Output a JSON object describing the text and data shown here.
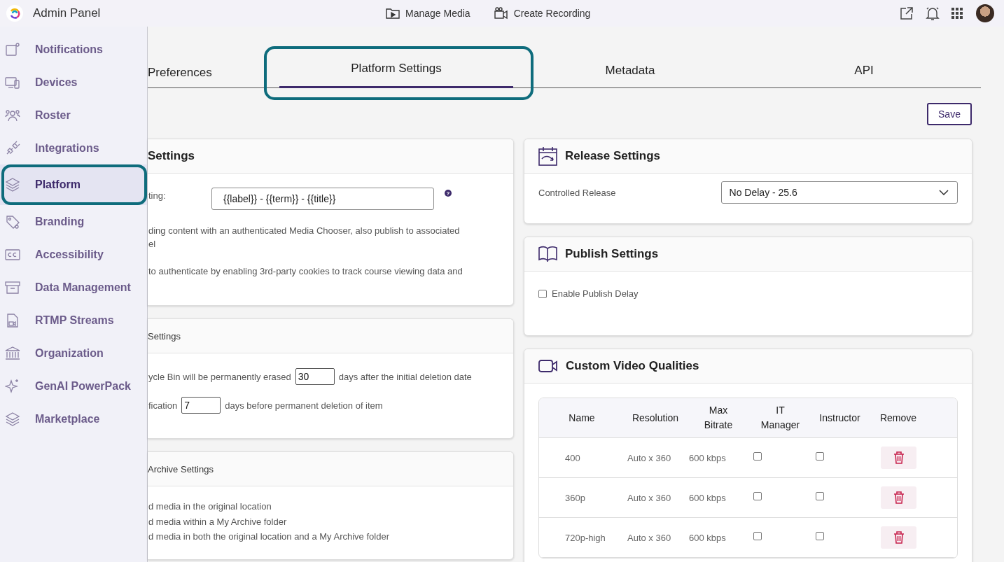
{
  "header": {
    "title": "Admin Panel",
    "actions": [
      {
        "label": "Manage Media"
      },
      {
        "label": "Create Recording"
      }
    ]
  },
  "sidebar": {
    "items": [
      {
        "label": "Notifications",
        "selected": false,
        "highlighted": false
      },
      {
        "label": "Devices",
        "selected": false,
        "highlighted": false
      },
      {
        "label": "Roster",
        "selected": false,
        "highlighted": false
      },
      {
        "label": "Integrations",
        "selected": false,
        "highlighted": false
      },
      {
        "label": "Platform",
        "selected": true,
        "highlighted": true
      },
      {
        "label": "Branding",
        "selected": false,
        "highlighted": false
      },
      {
        "label": "Accessibility",
        "selected": false,
        "highlighted": false
      },
      {
        "label": "Data Management",
        "selected": false,
        "highlighted": false
      },
      {
        "label": "RTMP Streams",
        "selected": false,
        "highlighted": false
      },
      {
        "label": "Organization",
        "selected": false,
        "highlighted": false
      },
      {
        "label": "GenAI PowerPack",
        "selected": false,
        "highlighted": false
      },
      {
        "label": "Marketplace",
        "selected": false,
        "highlighted": false
      }
    ]
  },
  "tabs": [
    {
      "label": "Preferences",
      "selected": false,
      "highlighted": false
    },
    {
      "label": "Platform Settings",
      "selected": true,
      "highlighted": true
    },
    {
      "label": "Metadata",
      "selected": false,
      "highlighted": false
    },
    {
      "label": "API",
      "selected": false,
      "highlighted": false
    }
  ],
  "save_button": "Save",
  "left_cards": [
    {
      "kind": "major",
      "title": "Settings",
      "rows": [
        {
          "kind": "field",
          "label": "ting:",
          "value": "{{label}} - {{term}} - {{title}}",
          "help": "?"
        },
        {
          "kind": "text",
          "text": "ding content with an authenticated Media Chooser, also publish to associated\nel"
        },
        {
          "kind": "text",
          "text": "to authenticate by enabling 3rd-party cookies to track course viewing data and"
        }
      ]
    },
    {
      "kind": "minor",
      "title": "Settings",
      "rows": [
        {
          "kind": "inline_input",
          "before": "ycle Bin will be permanently erased",
          "value": "30",
          "after": "days after the initial deletion date"
        },
        {
          "kind": "inline_input",
          "before": "fication",
          "value": "7",
          "after": "days before permanent deletion of item"
        }
      ]
    },
    {
      "kind": "minor",
      "title": "Archive Settings",
      "rows": [
        {
          "kind": "line",
          "text": "d media in the original location"
        },
        {
          "kind": "line",
          "text": "d media within a My Archive folder"
        },
        {
          "kind": "line",
          "text": "d media in both the original location and a My Archive folder"
        }
      ]
    }
  ],
  "right_cards": [
    {
      "kind": "major",
      "title": "Release Settings",
      "rows": [
        {
          "kind": "select",
          "label": "Controlled Release",
          "value": "No Delay - 25.6"
        }
      ]
    },
    {
      "kind": "major",
      "title": "Publish Settings",
      "rows": [
        {
          "kind": "checkbox",
          "label": "Enable Publish Delay",
          "checked": false
        }
      ]
    },
    {
      "kind": "major",
      "title": "Custom Video Qualities",
      "rows": [
        {
          "kind": "table",
          "columns": [
            "Name",
            "Resolution",
            "Max Bitrate",
            "IT Manager",
            "Instructor",
            "Remove"
          ],
          "rows": [
            {
              "name": "400",
              "resolution": "Auto x 360",
              "bitrate": "600 kbps",
              "it_manager": false,
              "instructor": false
            },
            {
              "name": "360p",
              "resolution": "Auto x 360",
              "bitrate": "600 kbps",
              "it_manager": false,
              "instructor": false
            },
            {
              "name": "720p-high",
              "resolution": "Auto x 360",
              "bitrate": "600 kbps",
              "it_manager": false,
              "instructor": false
            }
          ]
        }
      ]
    }
  ]
}
